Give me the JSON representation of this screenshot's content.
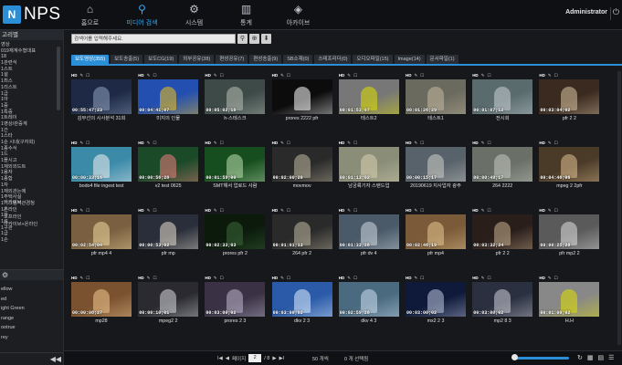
{
  "app": {
    "logo_mark": "N",
    "logo_text": "NPS"
  },
  "nav": [
    {
      "icon": "⌂",
      "label": "홈으로",
      "active": false
    },
    {
      "icon": "⚲",
      "label": "미디어 검색",
      "active": true
    },
    {
      "icon": "⚙",
      "label": "시스템",
      "active": false
    },
    {
      "icon": "▥",
      "label": "통계",
      "active": false
    },
    {
      "icon": "◈",
      "label": "아카이브",
      "active": false
    }
  ],
  "user": {
    "name": "Administrator",
    "power_icon": "⏻"
  },
  "sidebar": {
    "header": "고리별",
    "items": [
      "영상",
      "019재계수형대표",
      "18",
      "1관련식",
      "1스트",
      "1설",
      "1최스",
      "1리스트",
      "1급",
      "1아",
      "1중",
      "1특중",
      "1트레이",
      "1영상/관증계",
      "1간",
      "1스타",
      "1순 시네(구자회)",
      "1종수식",
      "1드",
      "1플시고",
      "1재외외드트",
      "1용자",
      "1종합",
      "1자",
      "1재외관는에 ",
      "1주택사실",
      "1기스템적관경청",
      "1손",
      "1파",
      "1료",
      "1구관",
      "1급",
      "1손"
    ],
    "group_items": [
      "아카이브",
      "온라인",
      "오프라인",
      "아카이브+온라인"
    ],
    "color_items": [
      "ellow",
      "ed",
      "ight Green",
      "range",
      "ootrue",
      "rey"
    ],
    "collapse_icon": "◀◀"
  },
  "search": {
    "placeholder": "검색어를 입력해주세요.",
    "value": "검색어를 입력해주세요."
  },
  "tabs": [
    {
      "label": "보도영상(355)",
      "active": true
    },
    {
      "label": "보도송출(5)",
      "active": false
    },
    {
      "label": "보도CG(19)",
      "active": false
    },
    {
      "label": "외부공유(38)",
      "active": false
    },
    {
      "label": "편성공유(7)",
      "active": false
    },
    {
      "label": "편성송출(9)",
      "active": false
    },
    {
      "label": "SB소재(0)",
      "active": false
    },
    {
      "label": "스테프리더(0)",
      "active": false
    },
    {
      "label": "오디오파일(15)",
      "active": false
    },
    {
      "label": "Image(14)",
      "active": false
    },
    {
      "label": "문서파일(1)",
      "active": false
    }
  ],
  "cells": [
    {
      "title": "김부선의 시사분석 31회",
      "dur": "00:55:47;23",
      "bg": "#1e2a45",
      "fg": "#8fa0c0"
    },
    {
      "title": "미지의 인물",
      "dur": "00:04:41;07",
      "bg": "#234fb0",
      "fg": "#f2c21a"
    },
    {
      "title": "h-스테스크",
      "dur": "00:05:02;16",
      "bg": "#3d4a48",
      "fg": "#b8c0b4"
    },
    {
      "title": "prores 2222 pfr",
      "dur": "",
      "bg": "#0c0c0c",
      "fg": "#ffffff"
    },
    {
      "title": "테스트2",
      "dur": "00:01:53;07",
      "bg": "#777777",
      "fg": "#e0e000"
    },
    {
      "title": "테스트1",
      "dur": "00:01:26;29",
      "bg": "#6a6a5e",
      "fg": "#c4b8a0"
    },
    {
      "title": "전시회",
      "dur": "00:01:07;12",
      "bg": "#5a6b6e",
      "fg": "#c8d0d4"
    },
    {
      "title": "pfr 2 2",
      "dur": "00:03:04;02",
      "bg": "#3a2a20",
      "fg": "#d8c4a0"
    },
    {
      "title": "bodo4 file ingest test",
      "dur": "00:00:33;16",
      "bg": "#3a8aa8",
      "fg": "#f0f0f0"
    },
    {
      "title": "v2 test 0625",
      "dur": "00:00:56;28",
      "bg": "#1a4a28",
      "fg": "#f08080"
    },
    {
      "title": "SMT해서 업로드 사람",
      "dur": "00:01:59;00",
      "bg": "#174e1f",
      "fg": "#c0e0b0"
    },
    {
      "title": "movmov",
      "dur": "00:02:00;20",
      "bg": "#2a2a2a",
      "fg": "#c0b8a0"
    },
    {
      "title": "남궁륙기자 스탠드업",
      "dur": "00:01:13;02",
      "bg": "#8a8e78",
      "fg": "#d8d0b0"
    },
    {
      "title": "20190619 지사업자 광주",
      "dur": "00:00:15;17",
      "bg": "#58626a",
      "fg": "#d0d0c8"
    },
    {
      "title": "264 2222",
      "dur": "00:00:49;17",
      "bg": "#6a7068",
      "fg": "#c4c8c0"
    },
    {
      "title": "mpeg 2 2pfr",
      "dur": "00:04:46;06",
      "bg": "#4a3a28",
      "fg": "#e0c090"
    },
    {
      "title": "pfr mp4 4",
      "dur": "00:02:54;04",
      "bg": "#7a6040",
      "fg": "#f0d8a0"
    },
    {
      "title": "pfr mp",
      "dur": "00:00:53;02",
      "bg": "#2a2e3a",
      "fg": "#e8e0d0"
    },
    {
      "title": "prores pfr 2",
      "dur": "00:02:33;03",
      "bg": "#0c1a0c",
      "fg": "#3a6a3a"
    },
    {
      "title": "264 pfr 2",
      "dur": "00:01:01;13",
      "bg": "#2a2a2a",
      "fg": "#c0b8a0"
    },
    {
      "title": "pfr dv 4",
      "dur": "00:01:33;28",
      "bg": "#4a5a68",
      "fg": "#d0d8e0"
    },
    {
      "title": "pfr mp4",
      "dur": "00:02:46;19",
      "bg": "#7a5a38",
      "fg": "#e8c890"
    },
    {
      "title": "pfr 2 2",
      "dur": "00:03:32;24",
      "bg": "#2a1e1a",
      "fg": "#c8b090"
    },
    {
      "title": "pfr mp2 2",
      "dur": "00:00:25;28",
      "bg": "#5a5a5a",
      "fg": "#e0e0e0"
    },
    {
      "title": "mp28",
      "dur": "00:00:08;27",
      "bg": "#7a5230",
      "fg": "#f0c890"
    },
    {
      "title": "mpeg2 2",
      "dur": "00:00:10;01",
      "bg": "#2a2a30",
      "fg": "#d8d8e0"
    },
    {
      "title": "prores 2 3",
      "dur": "00:03:00;02",
      "bg": "#3a3244",
      "fg": "#c0b8d0"
    },
    {
      "title": "dkv 2 3",
      "dur": "00:03:00;02",
      "bg": "#2a5aa8",
      "fg": "#e0f0ff"
    },
    {
      "title": "dkv 4 3",
      "dur": "00:02:59;28",
      "bg": "#4a6a80",
      "fg": "#d0e0f0"
    },
    {
      "title": "mx2 2 3",
      "dur": "00:03:00;02",
      "bg": "#0f1a3a",
      "fg": "#c0c8e0"
    },
    {
      "title": "mp2 8 3",
      "dur": "00:03:00;02",
      "bg": "#2a3040",
      "fg": "#d0d0d8"
    },
    {
      "title": "H.H",
      "dur": "00:01:00;02",
      "bg": "#888888",
      "fg": "#e0e000"
    }
  ],
  "footer": {
    "first": "I◀",
    "prev": "◀",
    "page_label": "페이지",
    "page_value": "2",
    "total": "/ 8",
    "next": "▶",
    "last": "▶I",
    "per_page": "50 개씩",
    "selected": "0 개 선택됨",
    "icons": [
      "↻",
      "▦",
      "▤",
      "☰"
    ]
  }
}
